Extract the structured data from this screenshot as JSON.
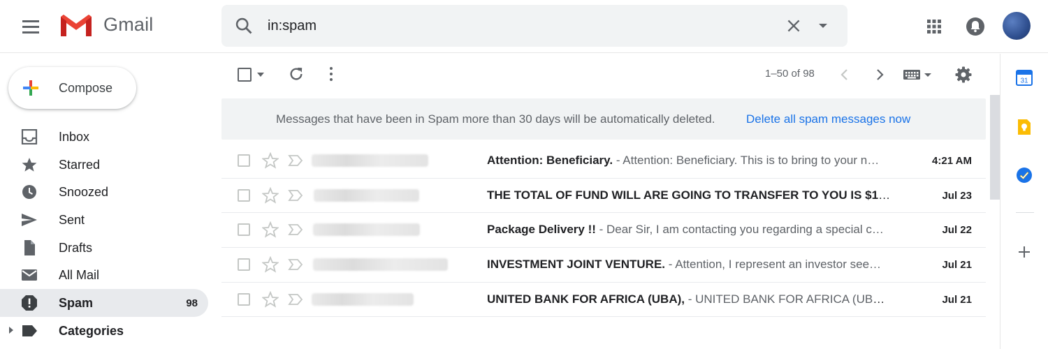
{
  "app": {
    "name": "Gmail"
  },
  "search": {
    "value": "in:spam"
  },
  "compose": {
    "label": "Compose"
  },
  "nav": {
    "items": [
      {
        "label": "Inbox",
        "icon": "inbox-icon"
      },
      {
        "label": "Starred",
        "icon": "star-icon"
      },
      {
        "label": "Snoozed",
        "icon": "clock-icon"
      },
      {
        "label": "Sent",
        "icon": "send-icon"
      },
      {
        "label": "Drafts",
        "icon": "draft-icon"
      },
      {
        "label": "All Mail",
        "icon": "mail-icon"
      },
      {
        "label": "Spam",
        "icon": "spam-icon",
        "count": "98",
        "active": true
      },
      {
        "label": "Categories",
        "icon": "label-icon"
      }
    ]
  },
  "toolbar": {
    "pager": "1–50 of 98"
  },
  "banner": {
    "text": "Messages that have been in Spam more than 30 days will be automatically deleted.",
    "link": "Delete all spam messages now"
  },
  "mails": [
    {
      "subject": "Attention: Beneficiary.",
      "snippet": " - Attention: Beneficiary. This is to bring to your n…",
      "date": "4:21 AM"
    },
    {
      "subject": "THE TOTAL OF FUND WILL ARE GOING TO TRANSFER TO YOU IS $1.5…",
      "snippet": "",
      "date": "Jul 23"
    },
    {
      "subject": "Package Delivery !!",
      "snippet": " - Dear Sir, I am contacting you regarding a special c…",
      "date": "Jul 22"
    },
    {
      "subject": "INVESTMENT JOINT VENTURE.",
      "snippet": " - Attention, I represent an investor see…",
      "date": "Jul 21"
    },
    {
      "subject": "UNITED BANK FOR AFRICA (UBA),",
      "snippet": " - UNITED BANK FOR AFRICA (UBA), …",
      "date": "Jul 21"
    }
  ],
  "side_panel": {
    "calendar_day": "31"
  },
  "colors": {
    "accent": "#1a73e8",
    "gmail_red": "#ea4335",
    "active_nav_bg": "#e8eaed",
    "search_bg": "#f1f3f4"
  }
}
